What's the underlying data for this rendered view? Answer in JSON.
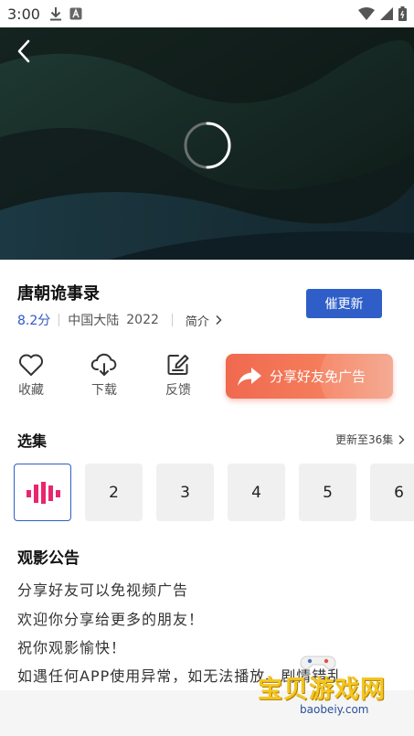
{
  "status_bar": {
    "time": "3:00",
    "icons": [
      "download-icon",
      "a-notification-icon",
      "wifi-icon",
      "signal-icon",
      "battery-icon"
    ]
  },
  "video": {
    "back_icon": "chevron-left-icon",
    "loading_icon": "loading-spinner-icon"
  },
  "info": {
    "title": "唐朝诡事录",
    "rating": "8.2分",
    "region": "中国大陆",
    "year": "2022",
    "intro_label": "简介",
    "update_button": "催更新"
  },
  "actions": [
    {
      "label": "收藏",
      "icon": "heart-icon"
    },
    {
      "label": "下载",
      "icon": "cloud-download-icon"
    },
    {
      "label": "反馈",
      "icon": "edit-icon"
    }
  ],
  "share_banner": {
    "label": "分享好友免广告",
    "icon": "share-arrow-icon"
  },
  "episodes": {
    "title": "选集",
    "more": "更新至36集",
    "items": [
      "",
      "2",
      "3",
      "4",
      "5",
      "6"
    ],
    "active_icon": "playing-bars-icon"
  },
  "notice": {
    "title": "观影公告",
    "lines": [
      "分享好友可以免视频广告",
      "欢迎你分享给更多的朋友！",
      "祝你观影愉快！",
      "如遇任何APP使用异常，如无法播放、剧情错乱"
    ]
  },
  "watermark": {
    "text": "宝贝游戏网",
    "url": "baobeiy.com"
  },
  "colors": {
    "accent": "#2f5ec9",
    "rating": "#2f58c6",
    "share": "#f0694f",
    "active_bars": "#e8266f"
  }
}
